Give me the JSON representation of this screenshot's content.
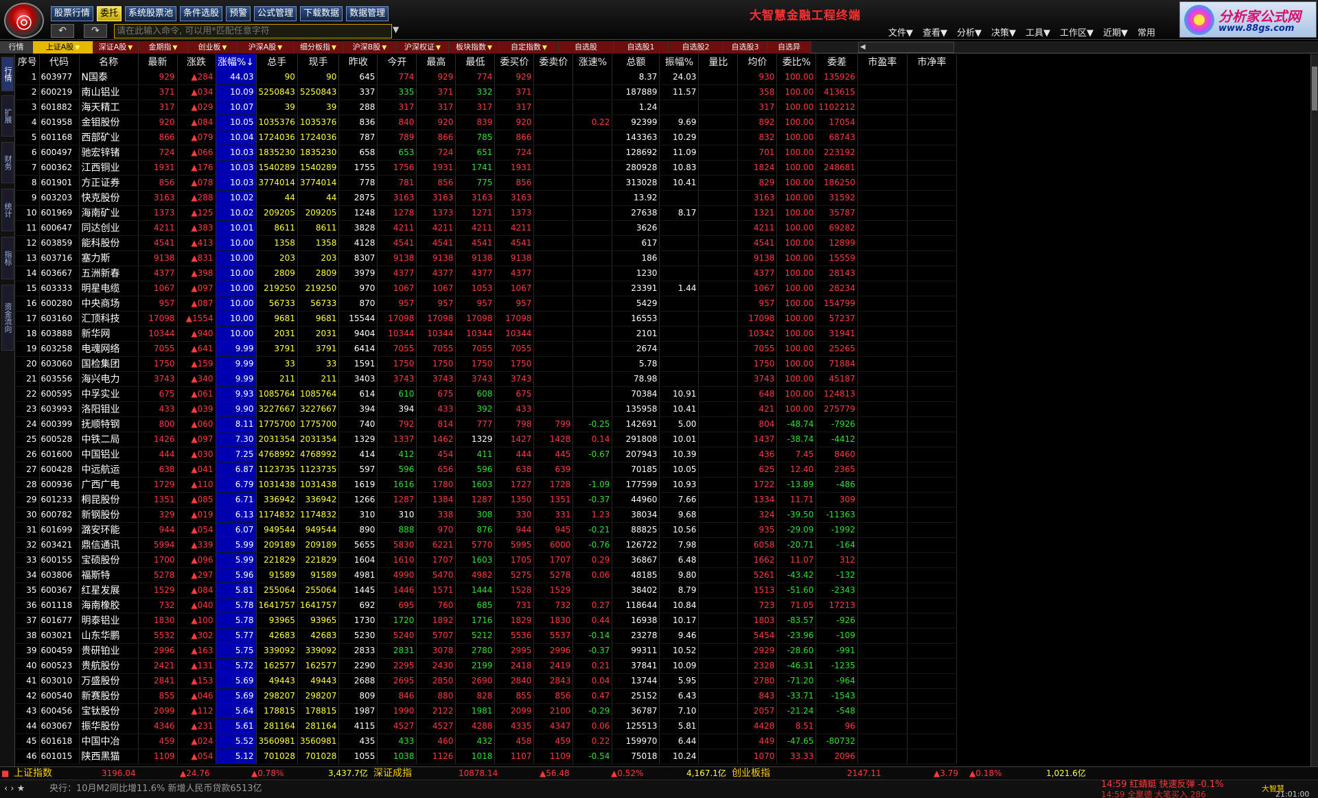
{
  "app": {
    "title": "大智慧金融工程终端",
    "brand_name": "分析家公式网",
    "brand_url": "www.88gs.com"
  },
  "menubar": {
    "items": [
      "股票行情",
      "委托",
      "系统股票池",
      "条件选股",
      "预警",
      "公式管理",
      "下载数据",
      "数据管理"
    ],
    "active": "委托"
  },
  "command": {
    "placeholder": "请在此输入命令, 可以用*匹配任意字符"
  },
  "right_menu": [
    "文件▼",
    "查看▼",
    "分析▼",
    "决策▼",
    "工具▼",
    "工作区▼",
    "近期▼",
    "常用"
  ],
  "market_tabs": [
    "行情",
    "上证A股",
    "深证A股",
    "金期指",
    "创业板",
    "沪深A股",
    "细分板指",
    "沪深B股",
    "沪深权证",
    "板块指数",
    "自定指数",
    "自选股",
    "自选股1",
    "自选股2",
    "自选股3",
    "自选异"
  ],
  "market_tabs_active": "上证A股",
  "side_tabs": [
    "行情",
    "扩展",
    "财务",
    "统计",
    "指标",
    "资金流向"
  ],
  "columns": [
    "序号",
    "代码",
    "名称",
    "最新",
    "涨跌",
    "涨幅%↓",
    "总手",
    "现手",
    "昨收",
    "今开",
    "最高",
    "最低",
    "委买价",
    "委卖价",
    "涨速%",
    "总额",
    "振幅%",
    "量比",
    "均价",
    "委比%",
    "委差",
    "市盈率",
    "市净率"
  ],
  "sort_column": "涨幅%↓",
  "rows": [
    [
      "1",
      "603977",
      "N国泰",
      "929",
      "▲284",
      "44.03",
      "90",
      "90",
      "645",
      "774",
      "929",
      "774",
      "929",
      "",
      "",
      "8.37",
      "24.03",
      "",
      "930",
      "100.00",
      "135926"
    ],
    [
      "2",
      "600219",
      "南山铝业",
      "371",
      "▲034",
      "10.09",
      "5250843",
      "5250843",
      "337",
      "335",
      "371",
      "332",
      "371",
      "",
      "",
      "187889",
      "11.57",
      "",
      "358",
      "100.00",
      "413615"
    ],
    [
      "3",
      "601882",
      "海天精工",
      "317",
      "▲029",
      "10.07",
      "39",
      "39",
      "288",
      "317",
      "317",
      "317",
      "317",
      "",
      "",
      "1.24",
      "",
      "",
      "317",
      "100.00",
      "1102212"
    ],
    [
      "4",
      "601958",
      "金钼股份",
      "920",
      "▲084",
      "10.05",
      "1035376",
      "1035376",
      "836",
      "840",
      "920",
      "839",
      "920",
      "",
      "0.22",
      "92399",
      "9.69",
      "",
      "892",
      "100.00",
      "17054"
    ],
    [
      "5",
      "601168",
      "西部矿业",
      "866",
      "▲079",
      "10.04",
      "1724036",
      "1724036",
      "787",
      "789",
      "866",
      "785",
      "866",
      "",
      "",
      "143363",
      "10.29",
      "",
      "832",
      "100.00",
      "68743"
    ],
    [
      "6",
      "600497",
      "驰宏锌锗",
      "724",
      "▲066",
      "10.03",
      "1835230",
      "1835230",
      "658",
      "653",
      "724",
      "651",
      "724",
      "",
      "",
      "128692",
      "11.09",
      "",
      "701",
      "100.00",
      "223192"
    ],
    [
      "7",
      "600362",
      "江西铜业",
      "1931",
      "▲176",
      "10.03",
      "1540289",
      "1540289",
      "1755",
      "1756",
      "1931",
      "1741",
      "1931",
      "",
      "",
      "280928",
      "10.83",
      "",
      "1824",
      "100.00",
      "248681"
    ],
    [
      "8",
      "601901",
      "方正证券",
      "856",
      "▲078",
      "10.03",
      "3774014",
      "3774014",
      "778",
      "781",
      "856",
      "775",
      "856",
      "",
      "",
      "313028",
      "10.41",
      "",
      "829",
      "100.00",
      "186250"
    ],
    [
      "9",
      "603203",
      "快克股份",
      "3163",
      "▲288",
      "10.02",
      "44",
      "44",
      "2875",
      "3163",
      "3163",
      "3163",
      "3163",
      "",
      "",
      "13.92",
      "",
      "",
      "3163",
      "100.00",
      "31592"
    ],
    [
      "10",
      "601969",
      "海南矿业",
      "1373",
      "▲125",
      "10.02",
      "209205",
      "209205",
      "1248",
      "1278",
      "1373",
      "1271",
      "1373",
      "",
      "",
      "27638",
      "8.17",
      "",
      "1321",
      "100.00",
      "35787"
    ],
    [
      "11",
      "600647",
      "同达创业",
      "4211",
      "▲383",
      "10.01",
      "8611",
      "8611",
      "3828",
      "4211",
      "4211",
      "4211",
      "4211",
      "",
      "",
      "3626",
      "",
      "",
      "4211",
      "100.00",
      "69282"
    ],
    [
      "12",
      "603859",
      "能科股份",
      "4541",
      "▲413",
      "10.00",
      "1358",
      "1358",
      "4128",
      "4541",
      "4541",
      "4541",
      "4541",
      "",
      "",
      "617",
      "",
      "",
      "4541",
      "100.00",
      "12899"
    ],
    [
      "13",
      "603716",
      "塞力斯",
      "9138",
      "▲831",
      "10.00",
      "203",
      "203",
      "8307",
      "9138",
      "9138",
      "9138",
      "9138",
      "",
      "",
      "186",
      "",
      "",
      "9138",
      "100.00",
      "15559"
    ],
    [
      "14",
      "603667",
      "五洲新春",
      "4377",
      "▲398",
      "10.00",
      "2809",
      "2809",
      "3979",
      "4377",
      "4377",
      "4377",
      "4377",
      "",
      "",
      "1230",
      "",
      "",
      "4377",
      "100.00",
      "28143"
    ],
    [
      "15",
      "603333",
      "明星电缆",
      "1067",
      "▲097",
      "10.00",
      "219250",
      "219250",
      "970",
      "1067",
      "1067",
      "1053",
      "1067",
      "",
      "",
      "23391",
      "1.44",
      "",
      "1067",
      "100.00",
      "28234"
    ],
    [
      "16",
      "600280",
      "中央商场",
      "957",
      "▲087",
      "10.00",
      "56733",
      "56733",
      "870",
      "957",
      "957",
      "957",
      "957",
      "",
      "",
      "5429",
      "",
      "",
      "957",
      "100.00",
      "154799"
    ],
    [
      "17",
      "603160",
      "汇顶科技",
      "17098",
      "▲1554",
      "10.00",
      "9681",
      "9681",
      "15544",
      "17098",
      "17098",
      "17098",
      "17098",
      "",
      "",
      "16553",
      "",
      "",
      "17098",
      "100.00",
      "57237"
    ],
    [
      "18",
      "603888",
      "新华网",
      "10344",
      "▲940",
      "10.00",
      "2031",
      "2031",
      "9404",
      "10344",
      "10344",
      "10344",
      "10344",
      "",
      "",
      "2101",
      "",
      "",
      "10342",
      "100.00",
      "31941"
    ],
    [
      "19",
      "603258",
      "电魂网络",
      "7055",
      "▲641",
      "9.99",
      "3791",
      "3791",
      "6414",
      "7055",
      "7055",
      "7055",
      "7055",
      "",
      "",
      "2674",
      "",
      "",
      "7055",
      "100.00",
      "25265"
    ],
    [
      "20",
      "603060",
      "国检集团",
      "1750",
      "▲159",
      "9.99",
      "33",
      "33",
      "1591",
      "1750",
      "1750",
      "1750",
      "1750",
      "",
      "",
      "5.78",
      "",
      "",
      "1750",
      "100.00",
      "71884"
    ],
    [
      "21",
      "603556",
      "海兴电力",
      "3743",
      "▲340",
      "9.99",
      "211",
      "211",
      "3403",
      "3743",
      "3743",
      "3743",
      "3743",
      "",
      "",
      "78.98",
      "",
      "",
      "3743",
      "100.00",
      "45187"
    ],
    [
      "22",
      "600595",
      "中孚实业",
      "675",
      "▲061",
      "9.93",
      "1085764",
      "1085764",
      "614",
      "610",
      "675",
      "608",
      "675",
      "",
      "",
      "70384",
      "10.91",
      "",
      "648",
      "100.00",
      "124813"
    ],
    [
      "23",
      "603993",
      "洛阳钼业",
      "433",
      "▲039",
      "9.90",
      "3227667",
      "3227667",
      "394",
      "394",
      "433",
      "392",
      "433",
      "",
      "",
      "135958",
      "10.41",
      "",
      "421",
      "100.00",
      "275779"
    ],
    [
      "24",
      "600399",
      "抚顺特钢",
      "800",
      "▲060",
      "8.11",
      "1775700",
      "1775700",
      "740",
      "792",
      "814",
      "777",
      "798",
      "799",
      "-0.25",
      "142691",
      "5.00",
      "",
      "804",
      "-48.74",
      "-7926"
    ],
    [
      "25",
      "600528",
      "中铁二局",
      "1426",
      "▲097",
      "7.30",
      "2031354",
      "2031354",
      "1329",
      "1337",
      "1462",
      "1329",
      "1427",
      "1428",
      "0.14",
      "291808",
      "10.01",
      "",
      "1437",
      "-38.74",
      "-4412"
    ],
    [
      "26",
      "601600",
      "中国铝业",
      "444",
      "▲030",
      "7.25",
      "4768992",
      "4768992",
      "414",
      "412",
      "454",
      "411",
      "444",
      "445",
      "-0.67",
      "207943",
      "10.39",
      "",
      "436",
      "7.45",
      "8460"
    ],
    [
      "27",
      "600428",
      "中远航运",
      "638",
      "▲041",
      "6.87",
      "1123735",
      "1123735",
      "597",
      "596",
      "656",
      "596",
      "638",
      "639",
      "",
      "70185",
      "10.05",
      "",
      "625",
      "12.40",
      "2365"
    ],
    [
      "28",
      "600936",
      "广西广电",
      "1729",
      "▲110",
      "6.79",
      "1031438",
      "1031438",
      "1619",
      "1616",
      "1780",
      "1603",
      "1727",
      "1728",
      "-1.09",
      "177599",
      "10.93",
      "",
      "1722",
      "-13.89",
      "-486"
    ],
    [
      "29",
      "601233",
      "桐昆股份",
      "1351",
      "▲085",
      "6.71",
      "336942",
      "336942",
      "1266",
      "1287",
      "1384",
      "1287",
      "1350",
      "1351",
      "-0.37",
      "44960",
      "7.66",
      "",
      "1334",
      "11.71",
      "309"
    ],
    [
      "30",
      "600782",
      "新钢股份",
      "329",
      "▲019",
      "6.13",
      "1174832",
      "1174832",
      "310",
      "310",
      "338",
      "308",
      "330",
      "331",
      "1.23",
      "38034",
      "9.68",
      "",
      "324",
      "-39.50",
      "-11363"
    ],
    [
      "31",
      "601699",
      "潞安环能",
      "944",
      "▲054",
      "6.07",
      "949544",
      "949544",
      "890",
      "888",
      "970",
      "876",
      "944",
      "945",
      "-0.21",
      "88825",
      "10.56",
      "",
      "935",
      "-29.09",
      "-1992"
    ],
    [
      "32",
      "603421",
      "鼎信通讯",
      "5994",
      "▲339",
      "5.99",
      "209189",
      "209189",
      "5655",
      "5830",
      "6221",
      "5770",
      "5995",
      "6000",
      "-0.76",
      "126722",
      "7.98",
      "",
      "6058",
      "-20.71",
      "-164"
    ],
    [
      "33",
      "600155",
      "宝硕股份",
      "1700",
      "▲096",
      "5.99",
      "221829",
      "221829",
      "1604",
      "1610",
      "1707",
      "1603",
      "1705",
      "1707",
      "0.29",
      "36867",
      "6.48",
      "",
      "1662",
      "11.07",
      "312"
    ],
    [
      "34",
      "603806",
      "福斯特",
      "5278",
      "▲297",
      "5.96",
      "91589",
      "91589",
      "4981",
      "4990",
      "5470",
      "4982",
      "5275",
      "5278",
      "0.06",
      "48185",
      "9.80",
      "",
      "5261",
      "-43.42",
      "-132"
    ],
    [
      "35",
      "600367",
      "红星发展",
      "1529",
      "▲084",
      "5.81",
      "255064",
      "255064",
      "1445",
      "1446",
      "1571",
      "1444",
      "1528",
      "1529",
      "",
      "38402",
      "8.79",
      "",
      "1513",
      "-51.60",
      "-2343"
    ],
    [
      "36",
      "601118",
      "海南橡胶",
      "732",
      "▲040",
      "5.78",
      "1641757",
      "1641757",
      "692",
      "695",
      "760",
      "685",
      "731",
      "732",
      "0.27",
      "118644",
      "10.84",
      "",
      "723",
      "71.05",
      "17213"
    ],
    [
      "37",
      "601677",
      "明泰铝业",
      "1830",
      "▲100",
      "5.78",
      "93965",
      "93965",
      "1730",
      "1720",
      "1892",
      "1716",
      "1829",
      "1830",
      "0.44",
      "16938",
      "10.17",
      "",
      "1803",
      "-83.57",
      "-926"
    ],
    [
      "38",
      "603021",
      "山东华鹏",
      "5532",
      "▲302",
      "5.77",
      "42683",
      "42683",
      "5230",
      "5240",
      "5707",
      "5212",
      "5536",
      "5537",
      "-0.14",
      "23278",
      "9.46",
      "",
      "5454",
      "-23.96",
      "-109"
    ],
    [
      "39",
      "600459",
      "贵研铂业",
      "2996",
      "▲163",
      "5.75",
      "339092",
      "339092",
      "2833",
      "2831",
      "3078",
      "2780",
      "2995",
      "2996",
      "-0.37",
      "99311",
      "10.52",
      "",
      "2929",
      "-28.60",
      "-991"
    ],
    [
      "40",
      "600523",
      "贵航股份",
      "2421",
      "▲131",
      "5.72",
      "162577",
      "162577",
      "2290",
      "2295",
      "2430",
      "2199",
      "2418",
      "2419",
      "0.21",
      "37841",
      "10.09",
      "",
      "2328",
      "-46.31",
      "-1235"
    ],
    [
      "41",
      "603010",
      "万盛股份",
      "2841",
      "▲153",
      "5.69",
      "49443",
      "49443",
      "2688",
      "2695",
      "2850",
      "2690",
      "2840",
      "2843",
      "0.04",
      "13744",
      "5.95",
      "",
      "2780",
      "-71.20",
      "-964"
    ],
    [
      "42",
      "600540",
      "新赛股份",
      "855",
      "▲046",
      "5.69",
      "298207",
      "298207",
      "809",
      "846",
      "880",
      "828",
      "855",
      "856",
      "0.47",
      "25152",
      "6.43",
      "",
      "843",
      "-33.71",
      "-1543"
    ],
    [
      "43",
      "600456",
      "宝钛股份",
      "2099",
      "▲112",
      "5.64",
      "178815",
      "178815",
      "1987",
      "1990",
      "2122",
      "1981",
      "2099",
      "2100",
      "-0.29",
      "36787",
      "7.10",
      "",
      "2057",
      "-21.24",
      "-548"
    ],
    [
      "44",
      "603067",
      "振华股份",
      "4346",
      "▲231",
      "5.61",
      "281164",
      "281164",
      "4115",
      "4527",
      "4527",
      "4288",
      "4335",
      "4347",
      "0.06",
      "125513",
      "5.81",
      "",
      "4428",
      "8.51",
      "96"
    ],
    [
      "45",
      "601618",
      "中国中冶",
      "459",
      "▲024",
      "5.52",
      "3560981",
      "3560981",
      "435",
      "433",
      "460",
      "432",
      "458",
      "459",
      "0.22",
      "159970",
      "6.44",
      "",
      "449",
      "-47.65",
      "-80732"
    ],
    [
      "46",
      "601015",
      "陕西黑猫",
      "1109",
      "▲054",
      "5.12",
      "701028",
      "701028",
      "1055",
      "1038",
      "1126",
      "1018",
      "1107",
      "1109",
      "-0.54",
      "75018",
      "10.24",
      "",
      "1070",
      "33.33",
      "2096"
    ]
  ],
  "statusbar": {
    "sh_name": "上证指数",
    "sh_value": "3196.04",
    "sh_change": "▲24.76",
    "sh_pct": "▲0.78%",
    "sh_amount": "3,437.7亿",
    "sz_name": "深证成指",
    "sz_value": "10878.14",
    "sz_change": "▲56.48",
    "sz_pct": "▲0.52%",
    "sz_amount": "4,167.1亿",
    "cy_name": "创业板指",
    "cy_value": "2147.11",
    "cy_change": "▲3.79",
    "cy_pct": "▲0.18%",
    "cy_amount": "1,021.6亿"
  },
  "news": {
    "ticker": "央行：10月M2同比增11.6% 新增人民币贷款6513亿",
    "alert1": "14:59 红蜻蜓 快速反弹 -0.1%",
    "alert2": "14:59 全聚德 大笔买入 286",
    "clock": "21:01:00",
    "mini_logo": "大智慧"
  },
  "colors": {
    "up": "#ff3b3b",
    "down": "#2fe02f",
    "sorted_col_bg": "#0000b0",
    "active_tab": "#e6b800",
    "tab_bg": "#6d0f0f"
  }
}
